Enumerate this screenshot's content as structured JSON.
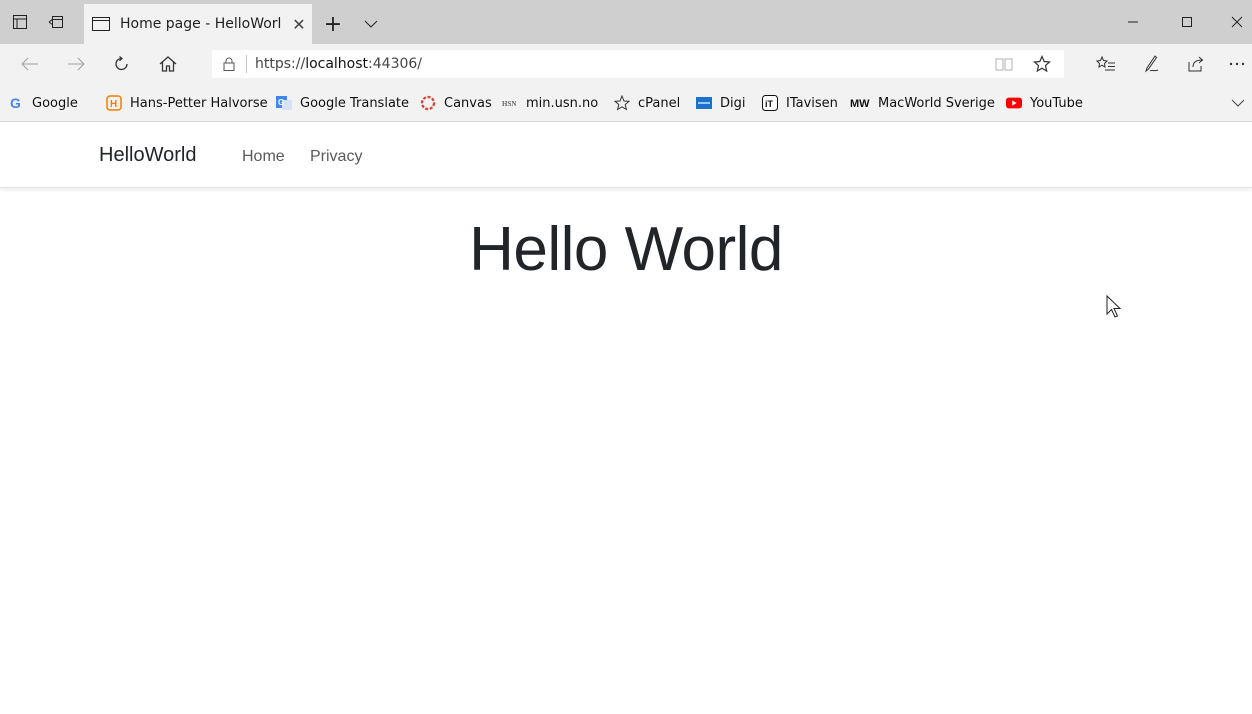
{
  "browser": {
    "tab": {
      "title": "Home page - HelloWorl"
    },
    "new_tab_label": "+",
    "address": {
      "scheme": "https://",
      "host": "localhost",
      "rest": ":44306/"
    },
    "favorites": [
      {
        "label": "Google",
        "icon": "google-icon",
        "color": "#4285f4"
      },
      {
        "label": "Hans-Petter Halvorse",
        "icon": "h-badge-icon",
        "color": "#f57c00"
      },
      {
        "label": "Google Translate",
        "icon": "translate-icon",
        "color": "#4285f4"
      },
      {
        "label": "Canvas",
        "icon": "canvas-icon",
        "color": "#e13f2b"
      },
      {
        "label": "min.usn.no",
        "icon": "usn-icon",
        "color": "#666666"
      },
      {
        "label": "cPanel",
        "icon": "star-icon",
        "color": "#333333"
      },
      {
        "label": "Digi",
        "icon": "digi-icon",
        "color": "#1a73c9"
      },
      {
        "label": "ITavisen",
        "icon": "itavisen-icon",
        "color": "#111111"
      },
      {
        "label": "MacWorld Sverige",
        "icon": "macworld-icon",
        "color": "#111111"
      },
      {
        "label": "YouTube",
        "icon": "youtube-icon",
        "color": "#ff0000"
      }
    ]
  },
  "site": {
    "brand": "HelloWorld",
    "nav": [
      {
        "label": "Home"
      },
      {
        "label": "Privacy"
      }
    ],
    "heading": "Hello World"
  }
}
